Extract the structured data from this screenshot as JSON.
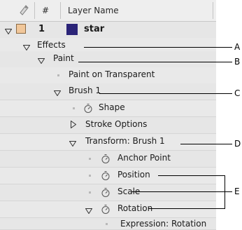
{
  "header": {
    "number_col": "#",
    "layer_name_col": "Layer Name"
  },
  "layer": {
    "index": "1",
    "name": "star",
    "label_color": "#f1c79a",
    "layer_color": "#2b2478"
  },
  "rows": {
    "effects": "Effects",
    "paint": "Paint",
    "paint_on_transparent": "Paint on Transparent",
    "brush1": "Brush 1",
    "shape": "Shape",
    "stroke_options": "Stroke Options",
    "transform_brush1": "Transform: Brush 1",
    "anchor_point": "Anchor Point",
    "position": "Position",
    "scale": "Scale",
    "rotation": "Rotation",
    "expression_rotation": "Expression: Rotation"
  },
  "callouts": {
    "a": "A",
    "b": "B",
    "c": "C",
    "d": "D",
    "e": "E"
  }
}
